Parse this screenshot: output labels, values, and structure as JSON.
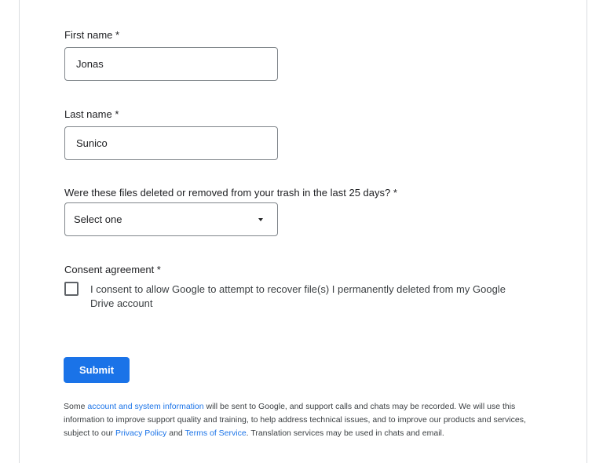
{
  "form": {
    "first_name": {
      "label": "First name *",
      "value": "Jonas"
    },
    "last_name": {
      "label": "Last name *",
      "value": "Sunico"
    },
    "deleted_question": {
      "label": "Were these files deleted or removed from your trash in the last 25 days? *",
      "selected": "Select one"
    },
    "consent": {
      "label": "Consent agreement *",
      "checked": false,
      "text": "I consent to allow Google to attempt to recover file(s) I permanently deleted from my Google Drive account"
    },
    "submit_label": "Submit"
  },
  "footer": {
    "text_1": "Some ",
    "link_account_info": "account and system information",
    "text_2": " will be sent to Google, and support calls and chats may be recorded. We will use this information to improve support quality and training, to help address technical issues, and to improve our products and services, subject to our ",
    "link_privacy": "Privacy Policy",
    "text_3": " and ",
    "link_terms": "Terms of Service",
    "text_4": ". Translation services may be used in chats and email."
  },
  "colors": {
    "primary": "#1a73e8",
    "border": "#80868b",
    "text": "#202124"
  }
}
